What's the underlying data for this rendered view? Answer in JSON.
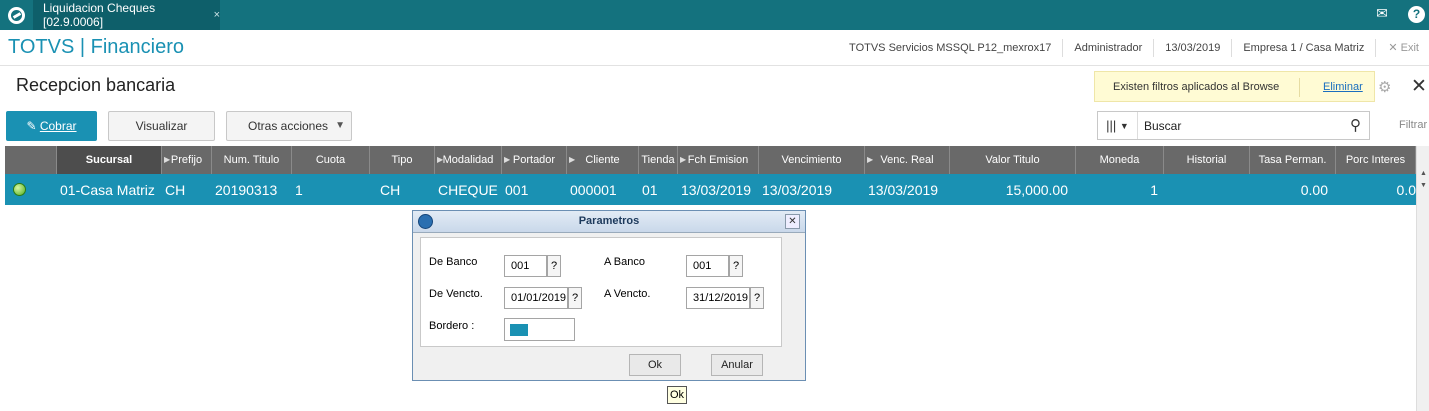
{
  "topbar": {
    "tab_label": "Liquidacion Cheques [02.9.0006]",
    "tab_close": "×"
  },
  "header": {
    "brand": "TOTVS | Financiero",
    "server": "TOTVS Servicios MSSQL P12_mexrox17",
    "user": "Administrador",
    "date": "13/03/2019",
    "company": "Empresa 1 / Casa Matriz",
    "exit": "Exit"
  },
  "page": {
    "title": "Recepcion bancaria",
    "filter_notice": "Existen filtros aplicados al Browse",
    "filter_remove": "Eliminar"
  },
  "toolbar": {
    "cobrar": "Cobrar",
    "visualizar": "Visualizar",
    "otras": "Otras acciones",
    "search_value": "Buscar",
    "filtrar": "Filtrar"
  },
  "grid": {
    "columns": [
      "Sucursal",
      "Prefijo",
      "Num. Titulo",
      "Cuota",
      "Tipo",
      "Modalidad",
      "Portador",
      "Cliente",
      "Tienda",
      "Fch Emision",
      "Vencimiento",
      "Venc. Real",
      "Valor Titulo",
      "Moneda",
      "Historial",
      "Tasa Perman.",
      "Porc Interes"
    ],
    "row": [
      "01-Casa Matriz",
      "CH",
      "20190313",
      "1",
      "CH",
      "CHEQUE",
      "001",
      "000001",
      "01",
      "13/03/2019",
      "13/03/2019",
      "13/03/2019",
      "15,000.00",
      "1",
      "",
      "0.00",
      "0.0"
    ]
  },
  "dialog": {
    "title": "Parametros",
    "de_banco_label": "De Banco",
    "de_banco_value": "001",
    "a_banco_label": "A  Banco",
    "a_banco_value": "001",
    "de_vencto_label": "De Vencto.",
    "de_vencto_value": "01/01/2019",
    "a_vencto_label": "A  Vencto.",
    "a_vencto_value": "31/12/2019",
    "bordero_label": "Bordero :",
    "help": "?",
    "ok": "Ok",
    "anular": "Anular",
    "bordero_color": "#1a91b3"
  },
  "tooltip": "Ok"
}
